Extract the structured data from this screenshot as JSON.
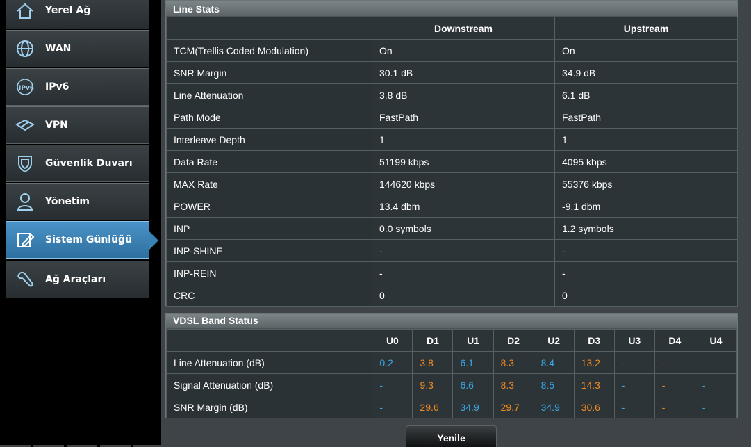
{
  "sidebar": {
    "items": [
      {
        "label": "Yerel Ağ",
        "icon": "home-icon"
      },
      {
        "label": "WAN",
        "icon": "globe-icon"
      },
      {
        "label": "IPv6",
        "icon": "ipv6-icon"
      },
      {
        "label": "VPN",
        "icon": "vpn-icon"
      },
      {
        "label": "Güvenlik Duvarı",
        "icon": "shield-icon"
      },
      {
        "label": "Yönetim",
        "icon": "user-icon"
      },
      {
        "label": "Sistem Günlüğü",
        "icon": "log-edit-icon",
        "active": true
      },
      {
        "label": "Ağ Araçları",
        "icon": "wrench-icon"
      }
    ]
  },
  "line_stats": {
    "title": "Line Stats",
    "headers": [
      "",
      "Downstream",
      "Upstream"
    ],
    "rows": [
      {
        "label": "TCM(Trellis Coded Modulation)",
        "down": "On",
        "up": "On"
      },
      {
        "label": "SNR Margin",
        "down": "30.1 dB",
        "up": "34.9 dB"
      },
      {
        "label": "Line Attenuation",
        "down": "3.8 dB",
        "up": "6.1 dB"
      },
      {
        "label": "Path Mode",
        "down": "FastPath",
        "up": "FastPath"
      },
      {
        "label": "Interleave Depth",
        "down": "1",
        "up": "1"
      },
      {
        "label": "Data Rate",
        "down": "51199 kbps",
        "up": "4095 kbps"
      },
      {
        "label": "MAX Rate",
        "down": "144620 kbps",
        "up": "55376 kbps"
      },
      {
        "label": "POWER",
        "down": "13.4 dbm",
        "up": "-9.1 dbm"
      },
      {
        "label": "INP",
        "down": "0.0 symbols",
        "up": "1.2 symbols"
      },
      {
        "label": "INP-SHINE",
        "down": "-",
        "up": "-"
      },
      {
        "label": "INP-REIN",
        "down": "-",
        "up": "-"
      },
      {
        "label": "CRC",
        "down": "0",
        "up": "0"
      }
    ]
  },
  "vdsl_band": {
    "title": "VDSL Band Status",
    "bands": [
      "U0",
      "D1",
      "U1",
      "D2",
      "U2",
      "D3",
      "U3",
      "D4",
      "U4"
    ],
    "rows": [
      {
        "label": "Line Attenuation (dB)",
        "values": [
          "0.2",
          "3.8",
          "6.1",
          "8.3",
          "8.4",
          "13.2",
          "-",
          "-",
          "-"
        ]
      },
      {
        "label": "Signal Attenuation (dB)",
        "values": [
          "-",
          "9.3",
          "6.6",
          "8.3",
          "8.5",
          "14.3",
          "-",
          "-",
          "-"
        ]
      },
      {
        "label": "SNR Margin (dB)",
        "values": [
          "-",
          "29.6",
          "34.9",
          "29.7",
          "34.9",
          "30.6",
          "-",
          "-",
          "-"
        ]
      }
    ],
    "colors": {
      "upstream": "#38a8e6",
      "downstream": "#f08a24"
    }
  },
  "refresh_button": {
    "label": "Yenile"
  }
}
